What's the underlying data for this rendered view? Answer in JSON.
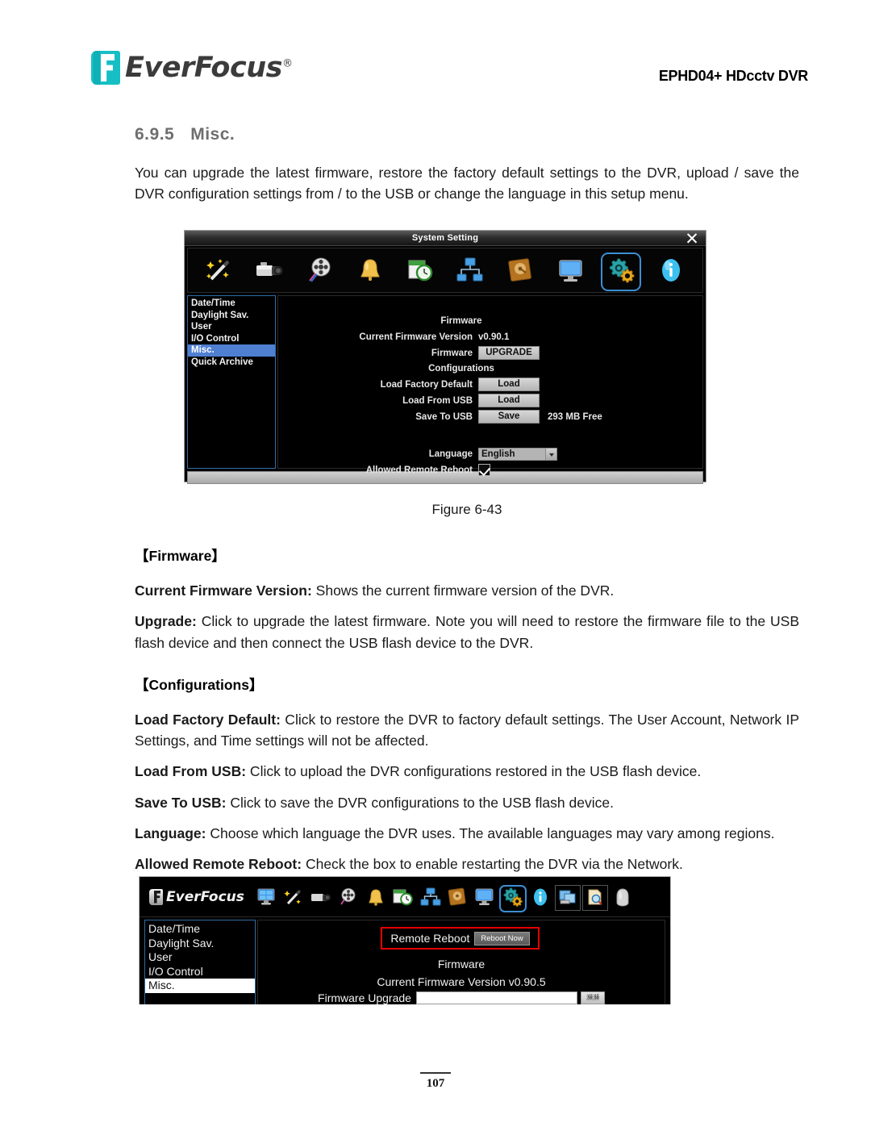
{
  "header": {
    "logo_text": "EverFocus",
    "logo_registered": "®",
    "model": "EPHD04+  HDcctv DVR"
  },
  "section": {
    "number": "6.9.5",
    "title": "Misc.",
    "intro": "You can upgrade the latest firmware, restore the factory default settings to the DVR, upload / save the DVR configuration settings from / to the USB or change the language in this setup menu."
  },
  "figure": {
    "caption": "Figure 6-43"
  },
  "firmware_block": {
    "heading": "【Firmware】",
    "items": [
      {
        "term": "Current Firmware Version:",
        "desc": " Shows the current firmware version of the DVR."
      },
      {
        "term": "Upgrade:",
        "desc": " Click to upgrade the latest firmware. Note you will need to restore the firmware file to the USB flash device and then connect the USB flash device to the DVR."
      }
    ]
  },
  "configurations_block": {
    "heading": "【Configurations】",
    "items": [
      {
        "term": "Load Factory Default:",
        "desc": " Click to restore the DVR to factory default settings. The User Account, Network IP Settings, and Time settings will not be affected."
      },
      {
        "term": "Load From USB:",
        "desc": " Click to upload the DVR configurations restored in the USB flash device."
      },
      {
        "term": "Save To USB:",
        "desc": " Click to save the DVR configurations to the USB flash device."
      },
      {
        "term": "Language:",
        "desc": " Choose which language the DVR uses. The available languages may vary among regions."
      },
      {
        "term": "Allowed Remote Reboot:",
        "desc": " Check the box to enable restarting the DVR via the Network."
      }
    ]
  },
  "dvr_dialog": {
    "title": "System Setting",
    "close_label": "✕",
    "toolbar_icons": [
      "magic-wand-icon",
      "camera-icon",
      "film-reel-icon",
      "bell-icon",
      "schedule-clock-icon",
      "network-icon",
      "disk-icon",
      "monitor-icon",
      "system-gears-icon",
      "info-icon"
    ],
    "selected_toolbar_icon": "system-gears-icon",
    "sidebar": [
      "Date/Time",
      "Daylight Sav.",
      "User",
      "I/O Control",
      "Misc.",
      "Quick Archive"
    ],
    "sidebar_selected": "Misc.",
    "firmware_section_label": "Firmware",
    "current_version_label": "Current Firmware Version",
    "current_version_value": "v0.90.1",
    "firmware_row_label": "Firmware",
    "upgrade_button": "UPGRADE",
    "configurations_section_label": "Configurations",
    "load_factory_default_label": "Load Factory Default",
    "load_factory_default_button": "Load",
    "load_from_usb_label": "Load From USB",
    "load_from_usb_button": "Load",
    "save_to_usb_label": "Save To USB",
    "save_to_usb_button": "Save",
    "free_space": "293 MB Free",
    "language_label": "Language",
    "language_value": "English",
    "allowed_remote_reboot_label": "Allowed Remote Reboot",
    "allowed_remote_reboot_checked": true
  },
  "dvr_web": {
    "logo_text": "EverFocus",
    "toolbar_icons": [
      "multiscreen-icon",
      "magic-wand-icon",
      "camera-icon",
      "film-reel-icon",
      "bell-icon",
      "schedule-clock-icon",
      "network-icon",
      "disk-icon",
      "monitor-icon",
      "system-gears-icon",
      "info-icon",
      "layout-icon",
      "search-doc-icon",
      "device-icon"
    ],
    "selected_toolbar_icon": "system-gears-icon",
    "sidebar": [
      "Date/Time",
      "Daylight Sav.",
      "User",
      "I/O Control",
      "Misc."
    ],
    "sidebar_selected": "Misc.",
    "remote_reboot_label": "Remote Reboot",
    "remote_reboot_button": "Reboot Now",
    "firmware_section_label": "Firmware",
    "current_version_line": "Current Firmware Version v0.90.5",
    "firmware_upgrade_label": "Firmware Upgrade",
    "browse_button": "瀕瀕"
  },
  "footer": {
    "page_number": "107"
  },
  "colors": {
    "brand_teal": "#16bfc4",
    "logo_gray": "#3b3b3b",
    "dvr_highlight_blue": "#4f7fd1",
    "selection_border": "#3b8fd4",
    "red_callout": "#e60000"
  }
}
